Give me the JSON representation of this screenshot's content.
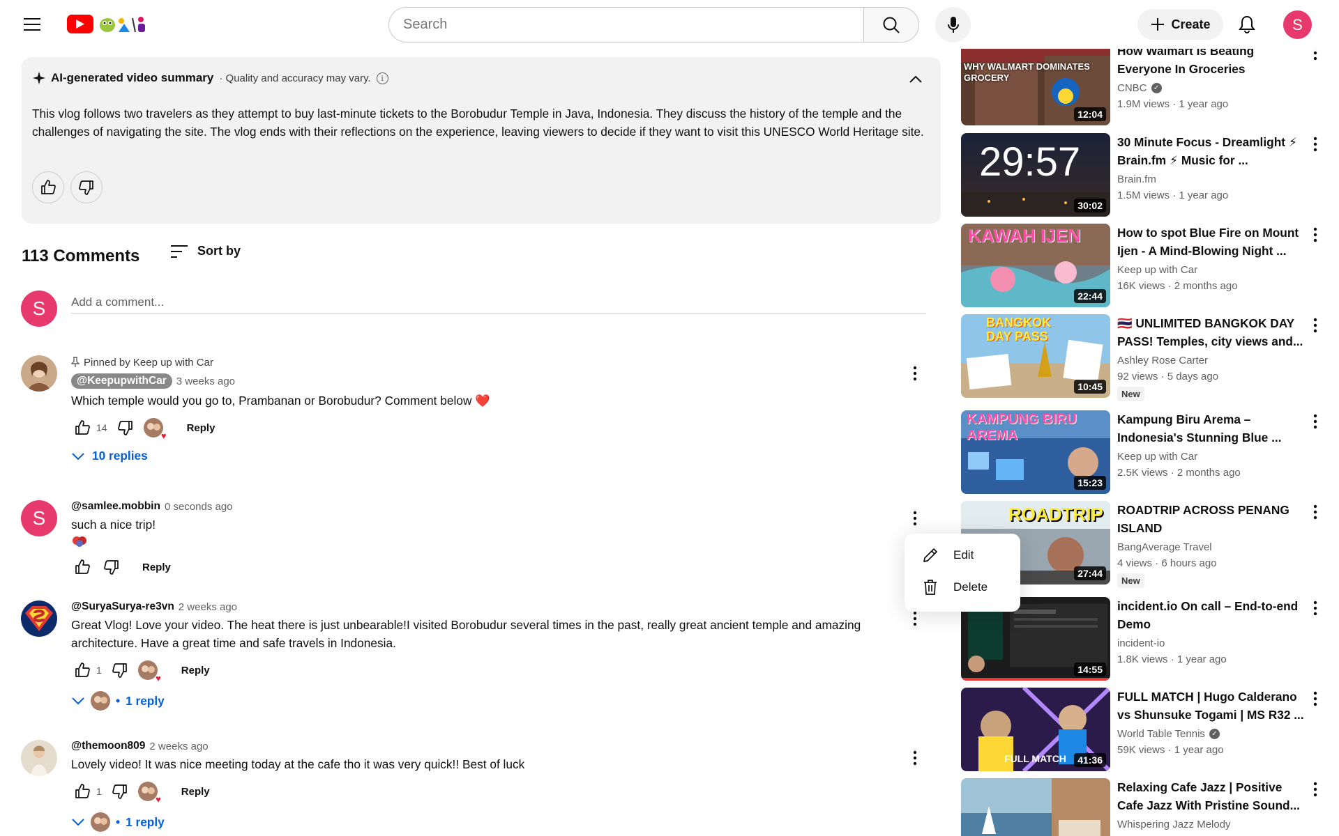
{
  "header": {
    "search_placeholder": "Search",
    "create_label": "Create",
    "user_initial": "S"
  },
  "summary": {
    "title": "AI-generated video summary",
    "note": "· Quality and accuracy may vary.",
    "text": "This vlog follows two travelers as they attempt to buy last-minute tickets to the Borobudur Temple in Java, Indonesia. They discuss the history of the temple and the challenges of navigating the site. The vlog ends with their reflections on the experience, leaving viewers to decide if they want to visit this UNESCO World Heritage site."
  },
  "comments_header": {
    "count": "113 Comments",
    "sort_label": "Sort by",
    "user_initial": "S",
    "add_placeholder": "Add a comment..."
  },
  "comments": [
    {
      "pinned": "Pinned by Keep up with Car",
      "author": "@KeepupwithCar",
      "time": "3 weeks ago",
      "text": "Which temple would you go to, Prambanan or Borobudur? Comment below ❤️",
      "likes": "14",
      "reply_label": "Reply",
      "replies": "10 replies"
    },
    {
      "author": "@samlee.mobbin",
      "time": "0 seconds ago",
      "text": "such a nice trip!",
      "user_initial": "S",
      "reply_label": "Reply"
    },
    {
      "author": "@SuryaSurya-re3vn",
      "time": "2 weeks ago",
      "text": "Great Vlog! Love your video. The heat there is just unbearable!I visited Borobudur several times in the past, really great ancient temple and amazing architecture. Have a great time and safe travels in Indonesia.",
      "likes": "1",
      "reply_label": "Reply",
      "replies": "1 reply"
    },
    {
      "author": "@themoon809",
      "time": "2 weeks ago",
      "text": "Lovely video! It was nice meeting today at the cafe tho it was very quick!! Best of luck",
      "likes": "1",
      "reply_label": "Reply",
      "replies": "1 reply"
    }
  ],
  "context_menu": {
    "edit": "Edit",
    "delete": "Delete"
  },
  "recommendations": [
    {
      "title": "How Walmart Is Beating Everyone In Groceries",
      "channel": "CNBC",
      "verified": true,
      "stats": "1.9M views · 1 year ago",
      "duration": "12:04",
      "thumb_text": "WHY WALMART DOMINATES GROCERY"
    },
    {
      "title": "30 Minute Focus - Dreamlight ⚡ Brain.fm ⚡ Music for ...",
      "channel": "Brain.fm",
      "stats": "1.5M views · 1 year ago",
      "duration": "30:02",
      "thumb_text": "29:57"
    },
    {
      "title": "How to spot Blue Fire on Mount Ijen - A Mind-Blowing Night ...",
      "channel": "Keep up with Car",
      "stats": "16K views · 2 months ago",
      "duration": "22:44",
      "thumb_text": "KAWAH IJEN"
    },
    {
      "title": "🇹🇭 UNLIMITED BANGKOK DAY PASS! Temples, city views and...",
      "channel": "Ashley Rose Carter",
      "stats": "92 views · 5 days ago",
      "duration": "10:45",
      "badge": "New",
      "thumb_text": "BANGKOK DAY PASS"
    },
    {
      "title": "Kampung Biru Arema – Indonesia's Stunning Blue ...",
      "channel": "Keep up with Car",
      "stats": "2.5K views · 2 months ago",
      "duration": "15:23",
      "thumb_text": "KAMPUNG BIRU AREMA"
    },
    {
      "title": "ROADTRIP ACROSS PENANG ISLAND",
      "channel": "BangAverage Travel",
      "stats": "4 views · 6 hours ago",
      "duration": "27:44",
      "badge": "New",
      "thumb_text": "ROADTRIP"
    },
    {
      "title": "incident.io On call – End-to-end Demo",
      "channel": "incident-io",
      "stats": "1.8K views · 1 year ago",
      "duration": "14:55",
      "thumb_text": ""
    },
    {
      "title": "FULL MATCH | Hugo Calderano vs Shunsuke Togami | MS R32 ...",
      "channel": "World Table Tennis",
      "verified": true,
      "stats": "59K views · 1 year ago",
      "duration": "41:36",
      "thumb_text": "FULL MATCH"
    },
    {
      "title": "Relaxing Cafe Jazz | Positive Cafe Jazz With Pristine Sound...",
      "channel": "Whispering Jazz Melody",
      "stats": "",
      "duration": "",
      "thumb_text": ""
    }
  ]
}
